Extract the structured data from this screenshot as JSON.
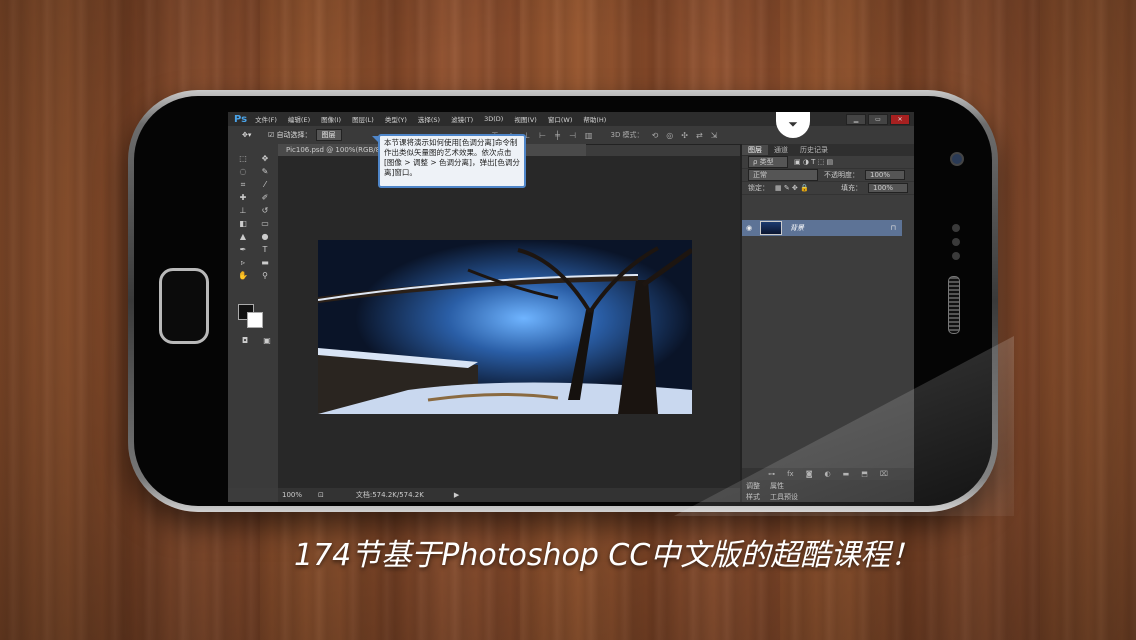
{
  "menubar": {
    "logo": "Ps",
    "items": [
      "文件(F)",
      "编辑(E)",
      "图像(I)",
      "图层(L)",
      "类型(Y)",
      "选择(S)",
      "滤镜(T)",
      "3D(D)",
      "视图(V)",
      "窗口(W)",
      "帮助(H)"
    ]
  },
  "options_bar": {
    "auto_select_label": "自动选择：",
    "auto_select_value": "图层",
    "mode_3d_label": "3D 模式："
  },
  "document": {
    "tab_title": "Pic106.psd @ 100%(RGB/8)"
  },
  "tooltip": {
    "text": "本节课将演示如何使用[色调分离]命令制作出类似矢量图的艺术效果。依次点击[图像 > 调整 > 色调分离]，弹出[色调分离]窗口。"
  },
  "statusbar": {
    "zoom": "100%",
    "doc_info": "文档:574.2K/574.2K",
    "arrow": "▶"
  },
  "layers_panel": {
    "tabs": [
      "图层",
      "通道",
      "历史记录"
    ],
    "filter_label": "ρ 类型",
    "blend_mode": "正常",
    "opacity_label": "不透明度：",
    "opacity_value": "100%",
    "lock_label": "锁定：",
    "fill_label": "填充：",
    "fill_value": "100%",
    "layer_name": "背景"
  },
  "bottom_panels": {
    "row1": [
      "调整",
      "属性"
    ],
    "row2": [
      "样式",
      "工具预设"
    ]
  },
  "caption": "174节基于Photoshop CC中文版的超酷课程！"
}
